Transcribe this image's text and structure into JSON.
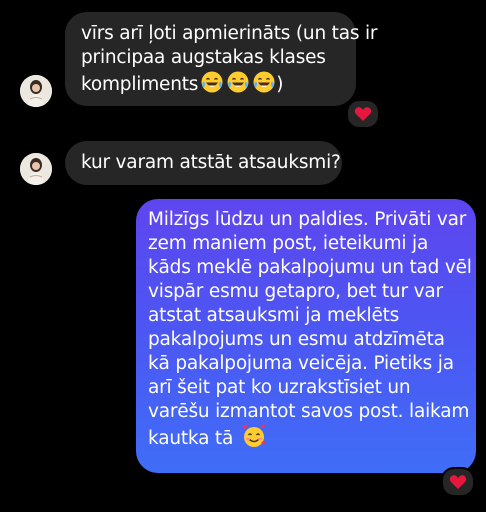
{
  "colors": {
    "background": "#000000",
    "incoming_bubble": "#262626",
    "outgoing_bubble_top": "#5e46ee",
    "outgoing_bubble_bottom": "#3f6df7",
    "text": "#ffffff",
    "heart": "#e5173f"
  },
  "messages": [
    {
      "direction": "incoming",
      "lines": [
        "vīrs arī ļoti apmierināts (un tas ir",
        "principaa augstakas klases",
        "kompliments"
      ],
      "trailing_text": ")",
      "emojis": [
        "laughing-tears-emoji",
        "laughing-tears-emoji",
        "laughing-tears-emoji"
      ],
      "reaction": "red-heart-icon"
    },
    {
      "direction": "incoming",
      "lines": [
        "kur varam atstāt atsauksmi?"
      ]
    },
    {
      "direction": "outgoing",
      "lines": [
        "Milzīgs lūdzu un paldies. Privāti var",
        "zem maniem post, ieteikumi ja",
        "kāds meklē pakalpojumu un tad vēl",
        "vispār esmu getapro, bet tur var",
        "atstat atsauksmi ja meklēts",
        "pakalpojums un esmu atdzīmēta",
        "kā pakalpojuma veicēja. Pietiks ja",
        "arī šeit pat ko uzrakstīsiet un",
        "varēšu izmantot savos post. laikam",
        "kautka tā"
      ],
      "emojis": [
        "smiling-face-with-hearts-emoji"
      ],
      "reaction": "red-heart-icon"
    }
  ]
}
